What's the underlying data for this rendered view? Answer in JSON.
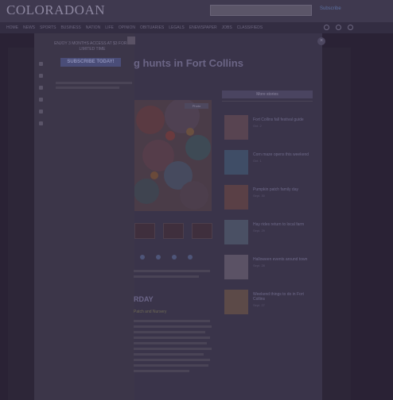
{
  "header": {
    "logo": "COLORADOAN",
    "subscribe_link": "Subscribe",
    "nav": [
      "Home",
      "News",
      "Sports",
      "Business",
      "Nation",
      "Life",
      "Opinion",
      "Obituaries",
      "Legals",
      "eNewspaper",
      "Jobs",
      "Classifieds"
    ]
  },
  "promo": {
    "headline": "Enjoy 3 months access at $3 for a limited time",
    "button_label": "Subscribe today!"
  },
  "article": {
    "headline_visible": "g hunts in Fort Collins",
    "hero_badge": "Photo",
    "section_heading": "RDAY",
    "sub_heading": "Patch and Nursery"
  },
  "right_rail": {
    "title": "More stories",
    "items": [
      {
        "title": "Fort Collins fall festival guide",
        "date": "Oct. 2"
      },
      {
        "title": "Corn maze opens this weekend",
        "date": "Oct. 1"
      },
      {
        "title": "Pumpkin patch family day",
        "date": "Sept. 30"
      },
      {
        "title": "Hay rides return to local farm",
        "date": "Sept. 29"
      },
      {
        "title": "Halloween events around town",
        "date": "Sept. 28"
      },
      {
        "title": "Weekend things to do in Fort Collins",
        "date": "Sept. 27"
      }
    ]
  }
}
